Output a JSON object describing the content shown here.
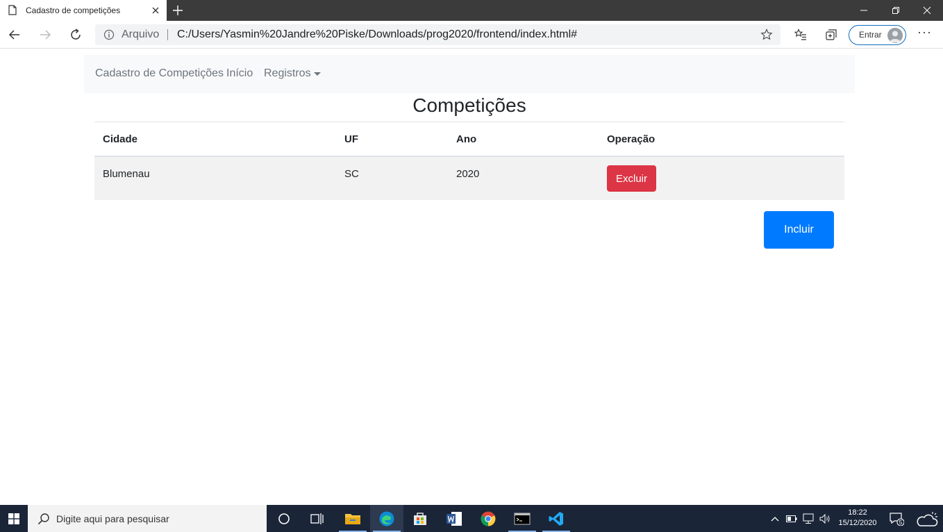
{
  "browser": {
    "tab_title": "Cadastro de competições",
    "address": {
      "scheme_label": "Arquivo",
      "url": "C:/Users/Yasmin%20Jandre%20Piske/Downloads/prog2020/frontend/index.html#"
    },
    "signin_label": "Entrar",
    "more_label": "···"
  },
  "navbar": {
    "brand": "Cadastro de Competições",
    "items": [
      {
        "label": "Início"
      },
      {
        "label": "Registros"
      }
    ]
  },
  "main": {
    "title": "Competições",
    "table": {
      "headers": [
        "Cidade",
        "UF",
        "Ano",
        "Operação"
      ],
      "rows": [
        {
          "cidade": "Blumenau",
          "uf": "SC",
          "ano": "2020",
          "action_label": "Excluir"
        }
      ]
    },
    "add_button_label": "Incluir"
  },
  "taskbar": {
    "search_placeholder": "Digite aqui para pesquisar",
    "time": "18:22",
    "date": "15/12/2020",
    "notification_count": "5"
  },
  "colors": {
    "danger": "#dc3545",
    "primary": "#007bff",
    "navbar_bg": "#f8f9fa",
    "taskbar_bg": "#1a2538"
  }
}
